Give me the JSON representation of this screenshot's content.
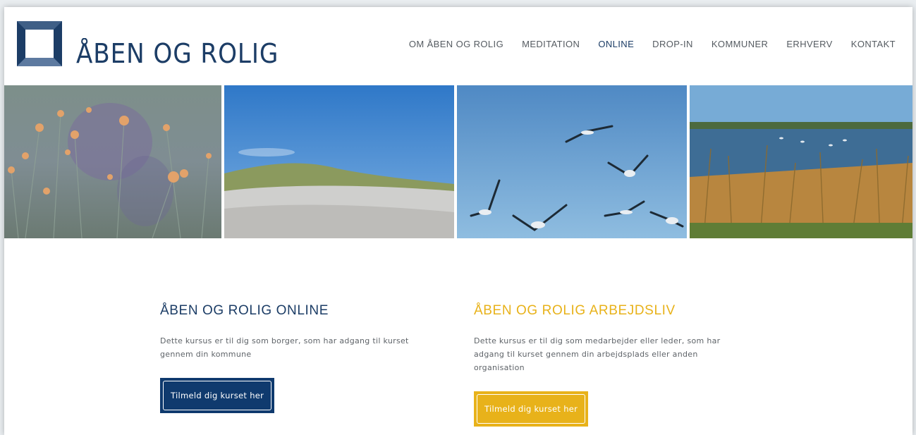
{
  "brand": {
    "name": "ÅBEN OG ROLIG"
  },
  "nav": {
    "items": [
      {
        "label": "OM ÅBEN OG ROLIG"
      },
      {
        "label": "MEDITATION"
      },
      {
        "label": "ONLINE"
      },
      {
        "label": "DROP-IN"
      },
      {
        "label": "KOMMUNER"
      },
      {
        "label": "ERHVERV"
      },
      {
        "label": "KONTAKT"
      }
    ],
    "active": "ONLINE"
  },
  "banner": {
    "images": [
      "flowers-photo",
      "dunes-photo",
      "seagulls-photo",
      "lake-reeds-photo"
    ]
  },
  "cards": [
    {
      "title": "ÅBEN OG ROLIG ONLINE",
      "text": "Dette kursus er til dig som borger, som har adgang til kurset gennem din kommune",
      "button": "Tilmeld dig kurset her"
    },
    {
      "title": "ÅBEN OG ROLIG ARBEJDSLIV",
      "text": "Dette kursus er til dig som medarbejder eller leder, som har adgang til kurset gennem din arbejdsplads eller anden organisation",
      "button": "Tilmeld dig kurset her"
    }
  ],
  "colors": {
    "brand_blue": "#1c3d66",
    "button_blue": "#0f3a6e",
    "accent_yellow": "#e8b21a"
  }
}
